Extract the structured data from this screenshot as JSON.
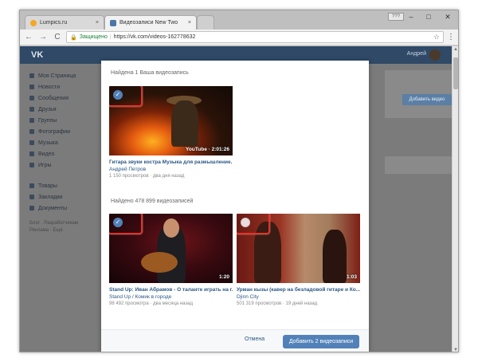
{
  "browser": {
    "tabs": [
      {
        "title": "Lumpics.ru",
        "close": "×"
      },
      {
        "title": "Видеозаписи New Two",
        "close": "×"
      }
    ],
    "window_user": "???",
    "window_controls": {
      "minimize": "–",
      "maximize": "□",
      "close": "✕"
    },
    "nav": {
      "back": "←",
      "forward": "→",
      "reload": "C"
    },
    "security_label": "Защищено",
    "url": "https://vk.com/videos-162778632",
    "star": "☆",
    "menu": "⋮"
  },
  "vk": {
    "logo": "VK",
    "user_name": "Андрей",
    "sidebar": [
      "Моя Страница",
      "Новости",
      "Сообщения",
      "Друзья",
      "Группы",
      "Фотографии",
      "Музыка",
      "Видео",
      "Игры"
    ],
    "sidebar_extra": [
      "Товары",
      "Закладки",
      "Документы"
    ],
    "sidebar_footer": "Блог · Разработчикам\nРеклама · Ещё",
    "add_video_button": "Добавить видео"
  },
  "modal": {
    "section_found_mine": "Найдена 1 Ваша видеозапись",
    "section_found_all": "Найдено 478 899 видеозаписей",
    "videos": [
      {
        "title": "Гитара звуки костра Музыка для размышление...",
        "author": "Андрей Петров",
        "meta": "1 150 просмотров · два дня назад",
        "duration": "YouTube · 2:01:26",
        "selected": true
      },
      {
        "title": "Stand Up: Иван Абрамов - О таланте играть на г...",
        "author": "Stand Up / Комик в городе",
        "meta": "98 492 просмотра · два месяца назад",
        "duration": "1:20",
        "selected": true
      },
      {
        "title": "Урман кызы (кавер на безладовой гитаре и Ко...",
        "author": "Djinn City",
        "meta": "501 319 просмотров · 19 дней назад",
        "duration": "1:03",
        "selected": false
      }
    ],
    "cancel_label": "Отмена",
    "add_label": "Добавить 2 видеозаписи",
    "check_mark": "✓"
  },
  "colors": {
    "vk_blue": "#5181b8",
    "link": "#2a5885",
    "highlight_red": "#e2342a",
    "vk_header": "#2f4966"
  }
}
